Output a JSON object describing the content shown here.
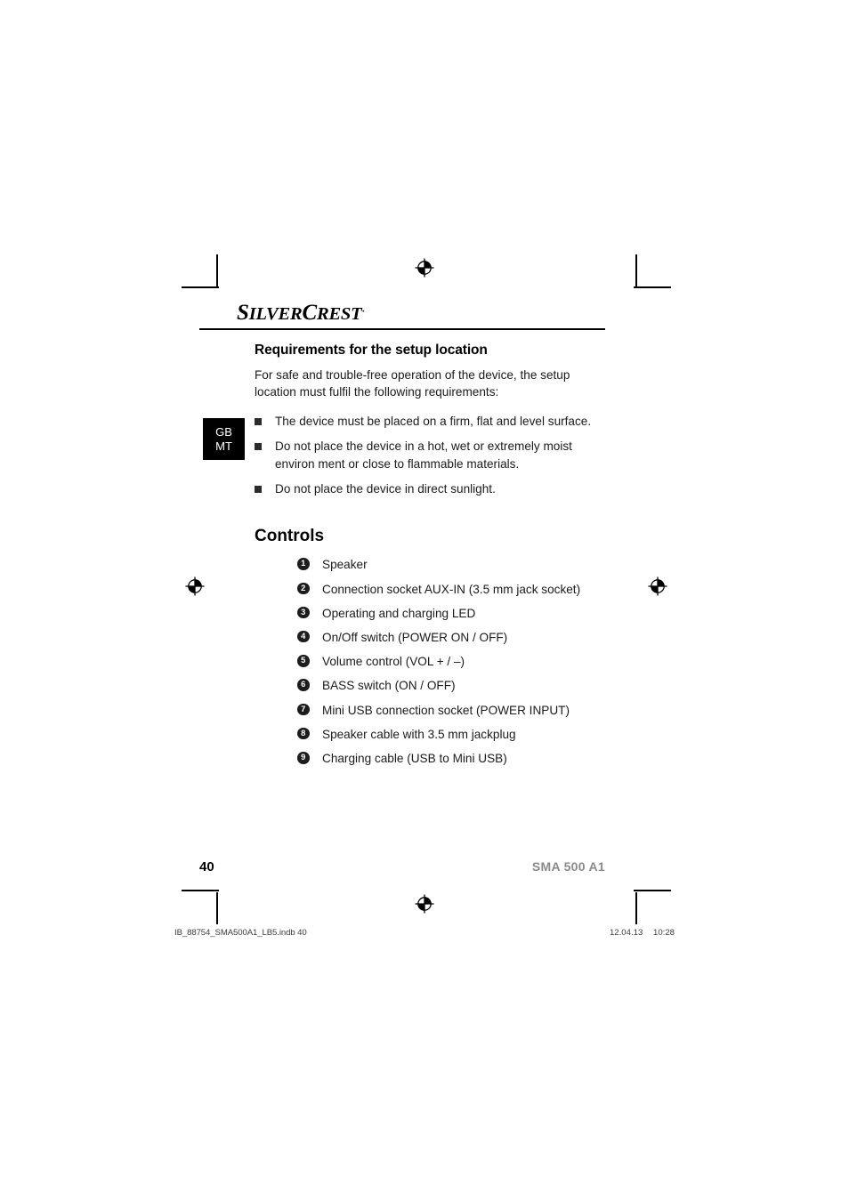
{
  "brand": {
    "name_part1": "S",
    "name_part2": "ILVER",
    "name_part3": "C",
    "name_part4": "REST",
    "registered_mark": "·"
  },
  "section": {
    "title": "Requirements for the setup location",
    "intro": "For safe and trouble-free operation of the device, the setup location must fulfil the following requirements:",
    "bullets": [
      "The device must be placed on a firm, flat and level surface.",
      "Do not place the device in a hot, wet or extremely moist environ­ ment or close to flammable materials.",
      "Do not place the device in direct sunlight."
    ]
  },
  "controls": {
    "title": "Controls",
    "items": [
      {
        "num": "1",
        "label": "Speaker"
      },
      {
        "num": "2",
        "label": "Connection socket AUX-IN (3.5 mm jack socket)"
      },
      {
        "num": "3",
        "label": "Operating and charging LED"
      },
      {
        "num": "4",
        "label": "On/Off switch (POWER ON / OFF)"
      },
      {
        "num": "5",
        "label": "Volume control (VOL + / –)"
      },
      {
        "num": "6",
        "label": "BASS switch (ON / OFF)"
      },
      {
        "num": "7",
        "label": "Mini USB connection socket (POWER INPUT)"
      },
      {
        "num": "8",
        "label": "Speaker cable with 3.5 mm jackplug"
      },
      {
        "num": "9",
        "label": "Charging cable (USB to Mini USB)"
      }
    ]
  },
  "language_tab": {
    "line1": "GB",
    "line2": "MT"
  },
  "footer": {
    "page_number": "40",
    "model": "SMA 500 A1"
  },
  "print_slug": {
    "file": "IB_88754_SMA500A1_LB5.indb   40",
    "date": "12.04.13",
    "time": "10:28"
  }
}
